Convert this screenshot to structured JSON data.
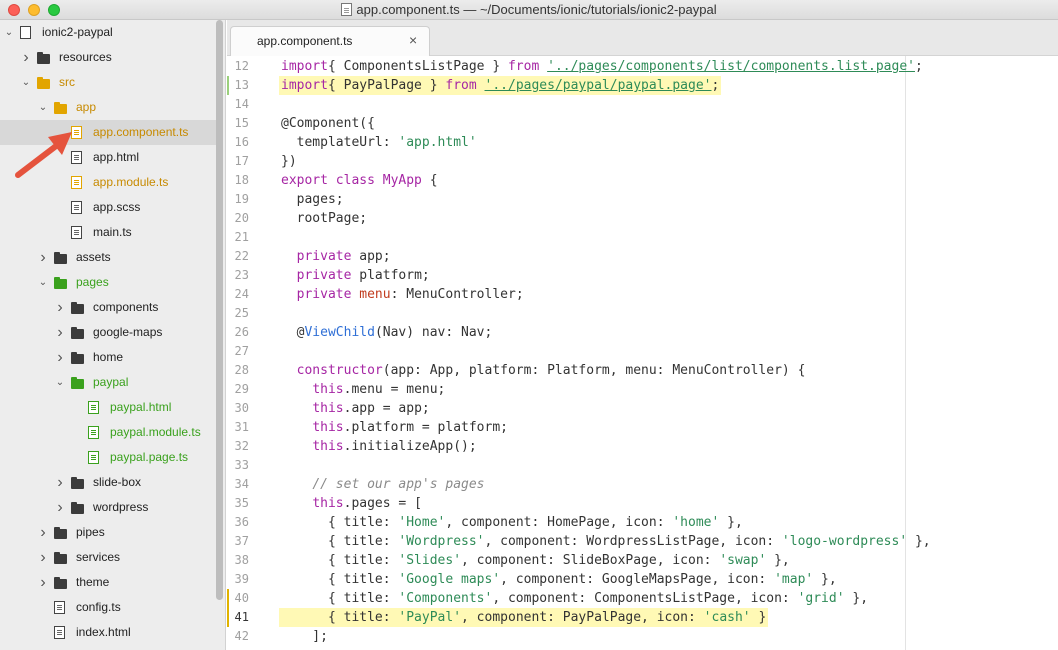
{
  "window": {
    "title": "app.component.ts — ~/Documents/ionic/tutorials/ionic2-paypal"
  },
  "sidebar": {
    "items": [
      {
        "label": "ionic2-paypal",
        "icon": "project-icon",
        "depth": 0,
        "chevron": "down"
      },
      {
        "label": "resources",
        "icon": "folder-icon",
        "depth": 1,
        "chevron": "right"
      },
      {
        "label": "src",
        "icon": "folder-icon",
        "depth": 1,
        "chevron": "down",
        "color": "orange"
      },
      {
        "label": "app",
        "icon": "folder-icon",
        "depth": 2,
        "chevron": "down",
        "color": "orange"
      },
      {
        "label": "app.component.ts",
        "icon": "file-icon",
        "depth": 3,
        "color": "orange",
        "selected": true
      },
      {
        "label": "app.html",
        "icon": "file-icon",
        "depth": 3
      },
      {
        "label": "app.module.ts",
        "icon": "file-icon",
        "depth": 3,
        "color": "orange"
      },
      {
        "label": "app.scss",
        "icon": "file-icon",
        "depth": 3
      },
      {
        "label": "main.ts",
        "icon": "file-icon",
        "depth": 3
      },
      {
        "label": "assets",
        "icon": "folder-icon",
        "depth": 2,
        "chevron": "right"
      },
      {
        "label": "pages",
        "icon": "folder-icon",
        "depth": 2,
        "chevron": "down",
        "color": "green"
      },
      {
        "label": "components",
        "icon": "folder-icon",
        "depth": 3,
        "chevron": "right"
      },
      {
        "label": "google-maps",
        "icon": "folder-icon",
        "depth": 3,
        "chevron": "right"
      },
      {
        "label": "home",
        "icon": "folder-icon",
        "depth": 3,
        "chevron": "right"
      },
      {
        "label": "paypal",
        "icon": "folder-icon",
        "depth": 3,
        "chevron": "down",
        "color": "green"
      },
      {
        "label": "paypal.html",
        "icon": "file-icon",
        "depth": 4,
        "color": "green"
      },
      {
        "label": "paypal.module.ts",
        "icon": "file-icon",
        "depth": 4,
        "color": "green"
      },
      {
        "label": "paypal.page.ts",
        "icon": "file-icon",
        "depth": 4,
        "color": "green"
      },
      {
        "label": "slide-box",
        "icon": "folder-icon",
        "depth": 3,
        "chevron": "right"
      },
      {
        "label": "wordpress",
        "icon": "folder-icon",
        "depth": 3,
        "chevron": "right"
      },
      {
        "label": "pipes",
        "icon": "folder-icon",
        "depth": 2,
        "chevron": "right"
      },
      {
        "label": "services",
        "icon": "folder-icon",
        "depth": 2,
        "chevron": "right"
      },
      {
        "label": "theme",
        "icon": "folder-icon",
        "depth": 2,
        "chevron": "right"
      },
      {
        "label": "config.ts",
        "icon": "file-icon",
        "depth": 2
      },
      {
        "label": "index.html",
        "icon": "file-icon",
        "depth": 2
      }
    ]
  },
  "tabs": [
    {
      "label": "app.component.ts",
      "close": "×"
    }
  ],
  "editor": {
    "lines": [
      {
        "n": "12",
        "mark": "",
        "hl": false,
        "tokens": [
          [
            "kw",
            "import"
          ],
          [
            "",
            "{ ComponentsListPage } "
          ],
          [
            "kw",
            "from"
          ],
          [
            "",
            " "
          ],
          [
            "strl",
            "'../pages/components/list/components.list.page'"
          ],
          [
            "",
            ";"
          ]
        ]
      },
      {
        "n": "13",
        "mark": "green",
        "hl": true,
        "tokens": [
          [
            "kw",
            "import"
          ],
          [
            "",
            "{ PayPalPage } "
          ],
          [
            "kw",
            "from"
          ],
          [
            "",
            " "
          ],
          [
            "strl",
            "'../pages/paypal/paypal.page'"
          ],
          [
            "",
            ";"
          ]
        ]
      },
      {
        "n": "14",
        "mark": "",
        "hl": false,
        "tokens": []
      },
      {
        "n": "15",
        "mark": "",
        "hl": false,
        "tokens": [
          [
            "",
            "@Component({"
          ]
        ]
      },
      {
        "n": "16",
        "mark": "",
        "hl": false,
        "tokens": [
          [
            "",
            "  templateUrl: "
          ],
          [
            "str",
            "'app.html'"
          ]
        ]
      },
      {
        "n": "17",
        "mark": "",
        "hl": false,
        "tokens": [
          [
            "",
            "})"
          ]
        ]
      },
      {
        "n": "18",
        "mark": "",
        "hl": false,
        "tokens": [
          [
            "kw",
            "export class "
          ],
          [
            "cls",
            "MyApp"
          ],
          [
            "",
            " {"
          ]
        ]
      },
      {
        "n": "19",
        "mark": "",
        "hl": false,
        "tokens": [
          [
            "",
            "  pages;"
          ]
        ]
      },
      {
        "n": "20",
        "mark": "",
        "hl": false,
        "tokens": [
          [
            "",
            "  rootPage;"
          ]
        ]
      },
      {
        "n": "21",
        "mark": "",
        "hl": false,
        "tokens": []
      },
      {
        "n": "22",
        "mark": "",
        "hl": false,
        "tokens": [
          [
            "",
            "  "
          ],
          [
            "kw",
            "private"
          ],
          [
            "",
            " app;"
          ]
        ]
      },
      {
        "n": "23",
        "mark": "",
        "hl": false,
        "tokens": [
          [
            "",
            "  "
          ],
          [
            "kw",
            "private"
          ],
          [
            "",
            " platform;"
          ]
        ]
      },
      {
        "n": "24",
        "mark": "",
        "hl": false,
        "tokens": [
          [
            "",
            "  "
          ],
          [
            "kw",
            "private"
          ],
          [
            "",
            " "
          ],
          [
            "prop",
            "menu"
          ],
          [
            "",
            ": MenuController;"
          ]
        ]
      },
      {
        "n": "25",
        "mark": "",
        "hl": false,
        "tokens": []
      },
      {
        "n": "26",
        "mark": "",
        "hl": false,
        "tokens": [
          [
            "",
            "  @"
          ],
          [
            "dec",
            "ViewChild"
          ],
          [
            "",
            "(Nav) nav: Nav;"
          ]
        ]
      },
      {
        "n": "27",
        "mark": "",
        "hl": false,
        "tokens": []
      },
      {
        "n": "28",
        "mark": "",
        "hl": false,
        "tokens": [
          [
            "",
            "  "
          ],
          [
            "kw",
            "constructor"
          ],
          [
            "",
            "(app: App, platform: Platform, menu: MenuController) {"
          ]
        ]
      },
      {
        "n": "29",
        "mark": "",
        "hl": false,
        "tokens": [
          [
            "",
            "    "
          ],
          [
            "kw",
            "this"
          ],
          [
            "",
            ".menu = menu;"
          ]
        ]
      },
      {
        "n": "30",
        "mark": "",
        "hl": false,
        "tokens": [
          [
            "",
            "    "
          ],
          [
            "kw",
            "this"
          ],
          [
            "",
            ".app = app;"
          ]
        ]
      },
      {
        "n": "31",
        "mark": "",
        "hl": false,
        "tokens": [
          [
            "",
            "    "
          ],
          [
            "kw",
            "this"
          ],
          [
            "",
            ".platform = platform;"
          ]
        ]
      },
      {
        "n": "32",
        "mark": "",
        "hl": false,
        "tokens": [
          [
            "",
            "    "
          ],
          [
            "kw",
            "this"
          ],
          [
            "",
            ".initializeApp();"
          ]
        ]
      },
      {
        "n": "33",
        "mark": "",
        "hl": false,
        "tokens": []
      },
      {
        "n": "34",
        "mark": "",
        "hl": false,
        "tokens": [
          [
            "",
            "    "
          ],
          [
            "cmt",
            "// set our app's pages"
          ]
        ]
      },
      {
        "n": "35",
        "mark": "",
        "hl": false,
        "tokens": [
          [
            "",
            "    "
          ],
          [
            "kw",
            "this"
          ],
          [
            "",
            ".pages = ["
          ]
        ]
      },
      {
        "n": "36",
        "mark": "",
        "hl": false,
        "tokens": [
          [
            "",
            "      { title: "
          ],
          [
            "str",
            "'Home'"
          ],
          [
            "",
            ", component: HomePage, icon: "
          ],
          [
            "str",
            "'home'"
          ],
          [
            "",
            " },"
          ]
        ]
      },
      {
        "n": "37",
        "mark": "",
        "hl": false,
        "tokens": [
          [
            "",
            "      { title: "
          ],
          [
            "str",
            "'Wordpress'"
          ],
          [
            "",
            ", component: WordpressListPage, icon: "
          ],
          [
            "str",
            "'logo-wordpress'"
          ],
          [
            "",
            " },"
          ]
        ]
      },
      {
        "n": "38",
        "mark": "",
        "hl": false,
        "tokens": [
          [
            "",
            "      { title: "
          ],
          [
            "str",
            "'Slides'"
          ],
          [
            "",
            ", component: SlideBoxPage, icon: "
          ],
          [
            "str",
            "'swap'"
          ],
          [
            "",
            " },"
          ]
        ]
      },
      {
        "n": "39",
        "mark": "",
        "hl": false,
        "tokens": [
          [
            "",
            "      { title: "
          ],
          [
            "str",
            "'Google maps'"
          ],
          [
            "",
            ", component: GoogleMapsPage, icon: "
          ],
          [
            "str",
            "'map'"
          ],
          [
            "",
            " },"
          ]
        ]
      },
      {
        "n": "40",
        "mark": "yellow",
        "hl": false,
        "tokens": [
          [
            "",
            "      { title: "
          ],
          [
            "str",
            "'Components'"
          ],
          [
            "",
            ", component: ComponentsListPage, icon: "
          ],
          [
            "str",
            "'grid'"
          ],
          [
            "",
            " },"
          ]
        ]
      },
      {
        "n": "41",
        "mark": "yellow",
        "hl": true,
        "current": true,
        "tokens": [
          [
            "",
            "      { title: "
          ],
          [
            "str",
            "'PayPal'"
          ],
          [
            "",
            ", component: PayPalPage, icon: "
          ],
          [
            "str",
            "'cash'"
          ],
          [
            "",
            " }"
          ]
        ]
      },
      {
        "n": "42",
        "mark": "",
        "hl": false,
        "tokens": [
          [
            "",
            "    ];"
          ]
        ]
      }
    ]
  },
  "colors": {
    "folder": "#3b3b3b",
    "modified": "#e2a500",
    "added": "#3aa11d",
    "highlight": "#fff9b5",
    "annotation_arrow": "#e5533d"
  }
}
